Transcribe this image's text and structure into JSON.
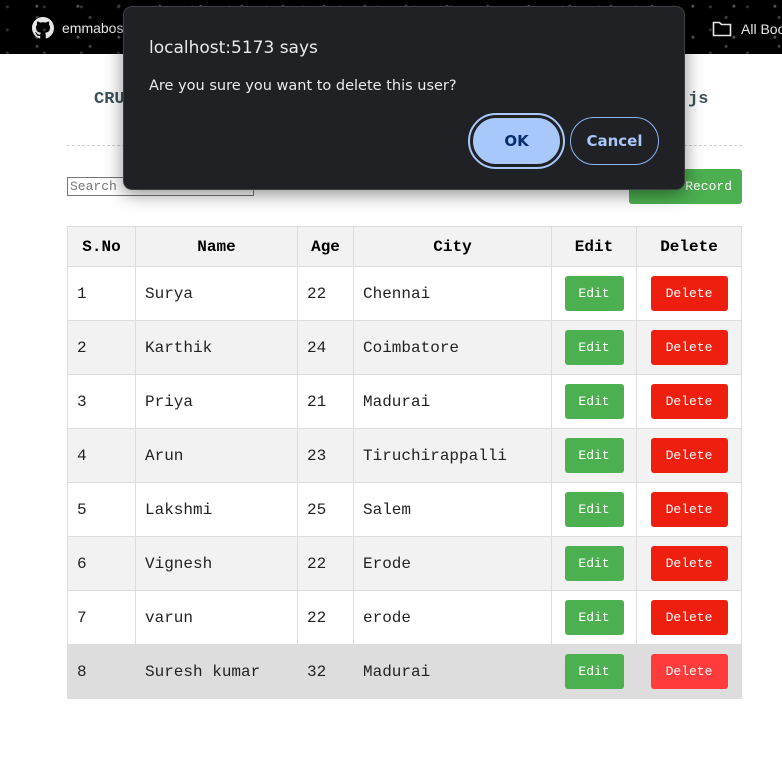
{
  "bookmarks": {
    "github_label": "emmabos",
    "all_bookmarks_label": "All Boo"
  },
  "page": {
    "title_left": "CRU",
    "title_right": "js",
    "search_placeholder": "Search",
    "add_button_label": "Record"
  },
  "table": {
    "headers": [
      "S.No",
      "Name",
      "Age",
      "City",
      "Edit",
      "Delete"
    ],
    "rows": [
      {
        "sno": "1",
        "name": "Surya",
        "age": "22",
        "city": "Chennai"
      },
      {
        "sno": "2",
        "name": "Karthik",
        "age": "24",
        "city": "Coimbatore"
      },
      {
        "sno": "3",
        "name": "Priya",
        "age": "21",
        "city": "Madurai"
      },
      {
        "sno": "4",
        "name": "Arun",
        "age": "23",
        "city": "Tiruchirappalli"
      },
      {
        "sno": "5",
        "name": "Lakshmi",
        "age": "25",
        "city": "Salem"
      },
      {
        "sno": "6",
        "name": "Vignesh",
        "age": "22",
        "city": "Erode"
      },
      {
        "sno": "7",
        "name": "varun",
        "age": "22",
        "city": "erode"
      },
      {
        "sno": "8",
        "name": "Suresh kumar",
        "age": "32",
        "city": "Madurai"
      }
    ],
    "edit_label": "Edit",
    "delete_label": "Delete"
  },
  "dialog": {
    "title": "localhost:5173 says",
    "message": "Are you sure you want to delete this user?",
    "ok_label": "OK",
    "cancel_label": "Cancel"
  },
  "colors": {
    "edit_button": "#4caf50",
    "delete_button": "#ef1f0f",
    "dialog_background": "#202124",
    "dialog_accent": "#a8c7fa"
  },
  "icons": {
    "github": "github-icon",
    "folder": "folder-icon"
  }
}
